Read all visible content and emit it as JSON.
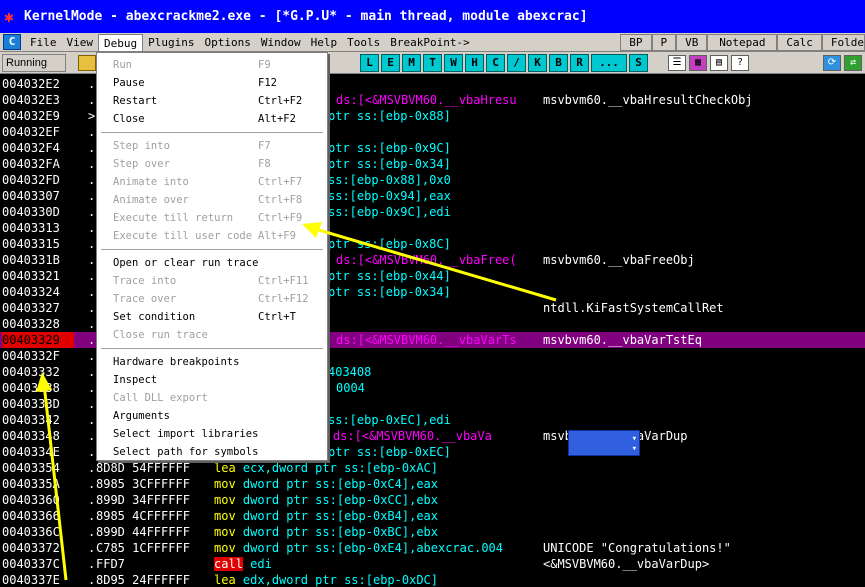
{
  "window": {
    "title": "KernelMode - abexcrackme2.exe - [*G.P.U* - main thread, module abexcrac]"
  },
  "menubar": {
    "c_label": "C",
    "items": [
      "File",
      "View",
      "Debug",
      "Plugins",
      "Options",
      "Window",
      "Help",
      "Tools",
      "BreakPoint->"
    ],
    "right_buttons": [
      "BP",
      "P",
      "VB",
      "Notepad",
      "Calc",
      "Folde"
    ]
  },
  "toolbar": {
    "status": "Running",
    "letter_buttons": [
      "L",
      "E",
      "M",
      "T",
      "W",
      "H",
      "C",
      "/",
      "K",
      "B",
      "R",
      "...",
      "S"
    ]
  },
  "code_rows": [
    {
      "addr": "004032E2",
      "col1": ".",
      "hex": "",
      "asm": "",
      "cmt": ""
    },
    {
      "addr": "004032E3",
      "col1": ".",
      "hex": "",
      "asm_pre": "",
      "asm_mag": "ds:[<&MSVBVM60.__vbaHresu",
      "asm_post": "",
      "cmt": "msvbvm60.__vbaHresultCheckObj"
    },
    {
      "addr": "004032E9",
      "col1": ">",
      "hex": "",
      "asm": "ptr ss:[ebp-0x88]",
      "cmt": ""
    },
    {
      "addr": "004032EF",
      "col1": ".",
      "hex": "",
      "asm": "",
      "cmt": ""
    },
    {
      "addr": "004032F4",
      "col1": ".",
      "hex": "",
      "asm": "ptr ss:[ebp-0x9C]",
      "cmt": ""
    },
    {
      "addr": "004032FA",
      "col1": ".",
      "hex": "",
      "asm": "ptr ss:[ebp-0x34]",
      "cmt": ""
    },
    {
      "addr": "004032FD",
      "col1": ".",
      "hex": "",
      "asm": "ss:[ebp-0x88],0x0",
      "cmt": ""
    },
    {
      "addr": "00403307",
      "col1": ".",
      "hex": "",
      "asm": "ss:[ebp-0x94],eax",
      "cmt": ""
    },
    {
      "addr": "0040330D",
      "col1": ".",
      "hex": "",
      "asm": "ss:[ebp-0x9C],edi",
      "cmt": ""
    },
    {
      "addr": "00403313",
      "col1": ".",
      "hex": "",
      "asm": "",
      "cmt": ""
    },
    {
      "addr": "00403315",
      "col1": ".",
      "hex": "",
      "asm": "ptr ss:[ebp-0x8C]",
      "cmt": ""
    },
    {
      "addr": "0040331B",
      "col1": ".",
      "hex": "",
      "asm_pre": "",
      "asm_mag": "ds:[<&MSVBVM60.__vbaFree(",
      "asm_post": "",
      "cmt": "msvbvm60.__vbaFreeObj"
    },
    {
      "addr": "00403321",
      "col1": ".",
      "hex": "",
      "asm": "ptr ss:[ebp-0x44]",
      "cmt": ""
    },
    {
      "addr": "00403324",
      "col1": ".",
      "hex": "",
      "asm": "ptr ss:[ebp-0x34]",
      "cmt": ""
    },
    {
      "addr": "00403327",
      "col1": ".",
      "hex": "",
      "asm": "",
      "cmt": "ntdll.KiFastSystemCallRet"
    },
    {
      "addr": "00403328",
      "col1": ".",
      "hex": "",
      "asm": "",
      "cmt": ""
    },
    {
      "addr": "00403329",
      "col1": ".",
      "hex": "",
      "asm_pre": "",
      "asm_mag": "ds:[<&MSVBVM60.__vbaVarTs",
      "asm_post": "",
      "cmt": "msvbvm60.__vbaVarTstEq",
      "selected": true
    },
    {
      "addr": "0040332F",
      "col1": ".",
      "hex": "",
      "asm": "",
      "cmt": ""
    },
    {
      "addr": "00403332",
      "col1": ".",
      "hex": "",
      "asm": "403408",
      "cmt": ""
    },
    {
      "addr": "00403338",
      "col1": ".",
      "hex": "",
      "asm_yel": "0004",
      "cmt": ""
    },
    {
      "addr": "0040333D",
      "col1": ".",
      "hex": "",
      "asm": "",
      "cmt": ""
    },
    {
      "addr": "00403342",
      "col1": ".",
      "hex": "",
      "asm": "ss:[ebp-0xEC],edi",
      "cmt": ""
    },
    {
      "addr": "00403348",
      "col1": ".",
      "hex": "",
      "asm_pre": "ptr ",
      "asm_mag": "ds:[<&MSVBVM60.__vbaVa",
      "asm_post": "",
      "cmt": "msvbvm60.__vbaVarDup"
    },
    {
      "addr": "0040334E",
      "col1": ".",
      "hex": "",
      "asm": "ptr ss:[ebp-0xEC]",
      "cmt": ""
    },
    {
      "addr": "00403354",
      "col1": ".",
      "hex": "8D8D 54FFFFFF",
      "op": "lea",
      "args": "ecx,dword ptr ss:[ebp-0xAC]",
      "cmt": ""
    },
    {
      "addr": "0040335A",
      "col1": ".",
      "hex": "8985 3CFFFFFF",
      "op": "mov",
      "args": "dword ptr ss:[ebp-0xC4],eax",
      "cmt": ""
    },
    {
      "addr": "00403360",
      "col1": ".",
      "hex": "899D 34FFFFFF",
      "op": "mov",
      "args": "dword ptr ss:[ebp-0xCC],ebx",
      "cmt": ""
    },
    {
      "addr": "00403366",
      "col1": ".",
      "hex": "8985 4CFFFFFF",
      "op": "mov",
      "args": "dword ptr ss:[ebp-0xB4],eax",
      "cmt": ""
    },
    {
      "addr": "0040336C",
      "col1": ".",
      "hex": "899D 44FFFFFF",
      "op": "mov",
      "args": "dword ptr ss:[ebp-0xBC],ebx",
      "cmt": ""
    },
    {
      "addr": "00403372",
      "col1": ".",
      "hex": "C785 1CFFFFFF",
      "op": "mov",
      "args": "dword ptr ss:[ebp-0xE4],abexcrac.004",
      "cmt": "UNICODE \"Congratulations!\""
    },
    {
      "addr": "0040337C",
      "col1": ".",
      "hex": "FFD7",
      "op": "call",
      "args": "edi",
      "cmt": "<&MSVBVM60.__vbaVarDup>",
      "call": true
    },
    {
      "addr": "0040337E",
      "col1": ".",
      "hex": "8D95 24FFFFFF",
      "op": "lea",
      "args": "edx,dword ptr ss:[ebp-0xDC]",
      "cmt": ""
    }
  ],
  "debug_menu": {
    "items": [
      {
        "label": "Run",
        "key": "F9",
        "disabled": true,
        "ul": "R"
      },
      {
        "label": "Pause",
        "key": "F12",
        "disabled": false,
        "ul": "P"
      },
      {
        "label": "Restart",
        "key": "Ctrl+F2",
        "disabled": false,
        "ul": "e"
      },
      {
        "label": "Close",
        "key": "Alt+F2",
        "disabled": false,
        "ul": "C"
      },
      {
        "sep": true
      },
      {
        "label": "Step into",
        "key": "F7",
        "disabled": true,
        "ul": "S"
      },
      {
        "label": "Step over",
        "key": "F8",
        "disabled": true,
        "ul": "o"
      },
      {
        "label": "Animate into",
        "key": "Ctrl+F7",
        "disabled": true,
        "ul": "A"
      },
      {
        "label": "Animate over",
        "key": "Ctrl+F8",
        "disabled": true,
        "ul": "n"
      },
      {
        "label": "Execute till return",
        "key": "Ctrl+F9",
        "disabled": true,
        "ul": "x"
      },
      {
        "label": "Execute till user code",
        "key": "Alt+F9",
        "disabled": true,
        "ul": "u"
      },
      {
        "sep": true
      },
      {
        "label": "Open or clear run trace",
        "key": "",
        "disabled": false,
        "ul": "O"
      },
      {
        "label": "Trace into",
        "key": "Ctrl+F11",
        "disabled": true,
        "ul": "T"
      },
      {
        "label": "Trace over",
        "key": "Ctrl+F12",
        "disabled": true,
        "ul": "v"
      },
      {
        "label": "Set condition",
        "key": "Ctrl+T",
        "disabled": false,
        "ul": "S"
      },
      {
        "label": "Close run trace",
        "key": "",
        "disabled": true,
        "ul": "l"
      },
      {
        "sep": true
      },
      {
        "label": "Hardware breakpoints",
        "key": "",
        "disabled": false,
        "ul": "H"
      },
      {
        "label": "Inspect",
        "key": "",
        "disabled": false,
        "ul": "I"
      },
      {
        "label": "Call DLL export",
        "key": "",
        "disabled": true,
        "ul": "D"
      },
      {
        "label": "Arguments",
        "key": "",
        "disabled": false,
        "ul": "A"
      },
      {
        "label": "Select import libraries",
        "key": "",
        "disabled": false,
        "ul": "l"
      },
      {
        "label": "Select path for symbols",
        "key": "",
        "disabled": false,
        "ul": "y"
      }
    ]
  },
  "colors": {
    "title_bg": "#0000ff",
    "selected_row": "#800080",
    "selected_addr": "#e00000",
    "asm_text": "#00ffff",
    "highlight_text": "#ff00ff",
    "annotation_arrow": "#ffff00"
  }
}
